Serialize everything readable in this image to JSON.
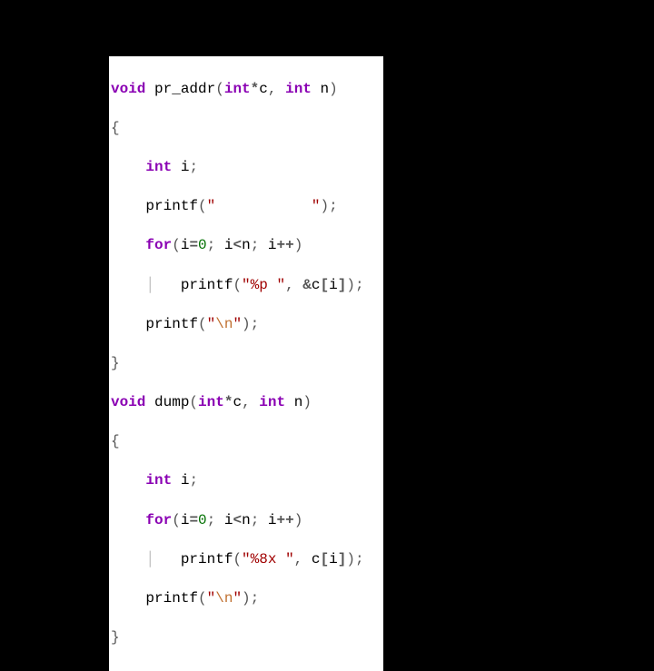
{
  "code": {
    "l1": {
      "void": "void",
      "sp": " ",
      "fn": "pr_addr",
      "lp": "(",
      "int1": "int",
      "star": "*",
      "c": "c",
      "comma": ",",
      "sp2": " ",
      "int2": "int",
      "sp3": " ",
      "n": "n",
      "rp": ")"
    },
    "l2": {
      "brace": "{"
    },
    "l3": {
      "indent": "    ",
      "int": "int",
      "sp": " ",
      "i": "i",
      "semi": ";"
    },
    "l4": {
      "indent": "    ",
      "printf": "printf",
      "lp": "(",
      "q1": "\"",
      "spaces": "           ",
      "q2": "\"",
      "rp": ")",
      "semi": ";"
    },
    "l5": {
      "indent": "    ",
      "for": "for",
      "lp": "(",
      "i": "i",
      "eq": "=",
      "zero": "0",
      "semi1": ";",
      "sp1": " ",
      "i2": "i",
      "lt": "<",
      "n": "n",
      "semi2": ";",
      "sp2": " ",
      "i3": "i",
      "pp": "++",
      "rp": ")"
    },
    "l6": {
      "indent": "    ",
      "vline": "│",
      "indent2": "   ",
      "printf": "printf",
      "lp": "(",
      "q1": "\"",
      "fmt": "%p ",
      "q2": "\"",
      "comma": ",",
      "sp": " ",
      "amp": "&",
      "c": "c",
      "lb": "[",
      "i": "i",
      "rb": "]",
      "rp": ")",
      "semi": ";"
    },
    "l7": {
      "indent": "    ",
      "printf": "printf",
      "lp": "(",
      "q1": "\"",
      "esc": "\\n",
      "q2": "\"",
      "rp": ")",
      "semi": ";"
    },
    "l8": {
      "brace": "}"
    },
    "l9": {
      "void": "void",
      "sp": " ",
      "fn": "dump",
      "lp": "(",
      "int1": "int",
      "star": "*",
      "c": "c",
      "comma": ",",
      "sp2": " ",
      "int2": "int",
      "sp3": " ",
      "n": "n",
      "rp": ")"
    },
    "l10": {
      "brace": "{"
    },
    "l11": {
      "indent": "    ",
      "int": "int",
      "sp": " ",
      "i": "i",
      "semi": ";"
    },
    "l12": {
      "indent": "    ",
      "for": "for",
      "lp": "(",
      "i": "i",
      "eq": "=",
      "zero": "0",
      "semi1": ";",
      "sp1": " ",
      "i2": "i",
      "lt": "<",
      "n": "n",
      "semi2": ";",
      "sp2": " ",
      "i3": "i",
      "pp": "++",
      "rp": ")"
    },
    "l13": {
      "indent": "    ",
      "vline": "│",
      "indent2": "   ",
      "printf": "printf",
      "lp": "(",
      "q1": "\"",
      "fmt": "%8x ",
      "q2": "\"",
      "comma": ",",
      "sp": " ",
      "c": "c",
      "lb": "[",
      "i": "i",
      "rb": "]",
      "rp": ")",
      "semi": ";"
    },
    "l14": {
      "indent": "    ",
      "printf": "printf",
      "lp": "(",
      "q1": "\"",
      "esc": "\\n",
      "q2": "\"",
      "rp": ")",
      "semi": ";"
    },
    "l15": {
      "brace": "}"
    }
  }
}
